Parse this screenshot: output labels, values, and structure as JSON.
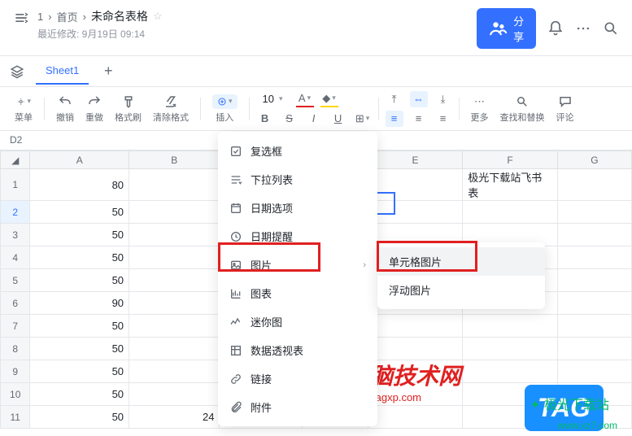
{
  "header": {
    "breadcrumb": [
      "1",
      "首页",
      "未命名表格"
    ],
    "sep": "›",
    "modified_label": "最近修改: 9月19日 09:14",
    "share_label": "分享"
  },
  "tabs": {
    "active": "Sheet1"
  },
  "toolbar": {
    "menu": "菜单",
    "undo": "撤销",
    "redo": "重做",
    "format_painter": "格式刷",
    "clear_format": "清除格式",
    "insert": "插入",
    "font_size": "10",
    "more": "更多",
    "find_replace": "查找和替换",
    "comments": "评论"
  },
  "cell_ref": "D2",
  "columns": [
    "A",
    "B",
    "C",
    "D",
    "E",
    "F",
    "G"
  ],
  "rows": [
    {
      "n": 1,
      "a": "80",
      "f": "极光下载站飞书表"
    },
    {
      "n": 2,
      "a": "50"
    },
    {
      "n": 3,
      "a": "50"
    },
    {
      "n": 4,
      "a": "50"
    },
    {
      "n": 5,
      "a": "50"
    },
    {
      "n": 6,
      "a": "90"
    },
    {
      "n": 7,
      "a": "50"
    },
    {
      "n": 8,
      "a": "50"
    },
    {
      "n": 9,
      "a": "50"
    },
    {
      "n": 10,
      "a": "50"
    },
    {
      "n": 11,
      "a": "50",
      "b": "24"
    }
  ],
  "insert_menu": {
    "items": [
      {
        "icon": "checkbox",
        "label": "复选框"
      },
      {
        "icon": "dropdown",
        "label": "下拉列表"
      },
      {
        "icon": "calendar",
        "label": "日期选项"
      },
      {
        "icon": "clock",
        "label": "日期提醒"
      },
      {
        "icon": "image",
        "label": "图片",
        "submenu": true,
        "highlight": true
      },
      {
        "icon": "chart",
        "label": "图表"
      },
      {
        "icon": "spark",
        "label": "迷你图"
      },
      {
        "icon": "pivot",
        "label": "数据透视表"
      },
      {
        "icon": "link",
        "label": "链接"
      },
      {
        "icon": "attach",
        "label": "附件"
      }
    ]
  },
  "image_submenu": {
    "items": [
      {
        "label": "单元格图片",
        "selected": true,
        "highlight": true
      },
      {
        "label": "浮动图片"
      }
    ]
  },
  "watermark": {
    "title": "电脑技术网",
    "url": "www.tagxp.com",
    "tag": "TAG",
    "jg": "极光下载站",
    "jg_url": "www.xz7.com"
  },
  "chart_data": null
}
